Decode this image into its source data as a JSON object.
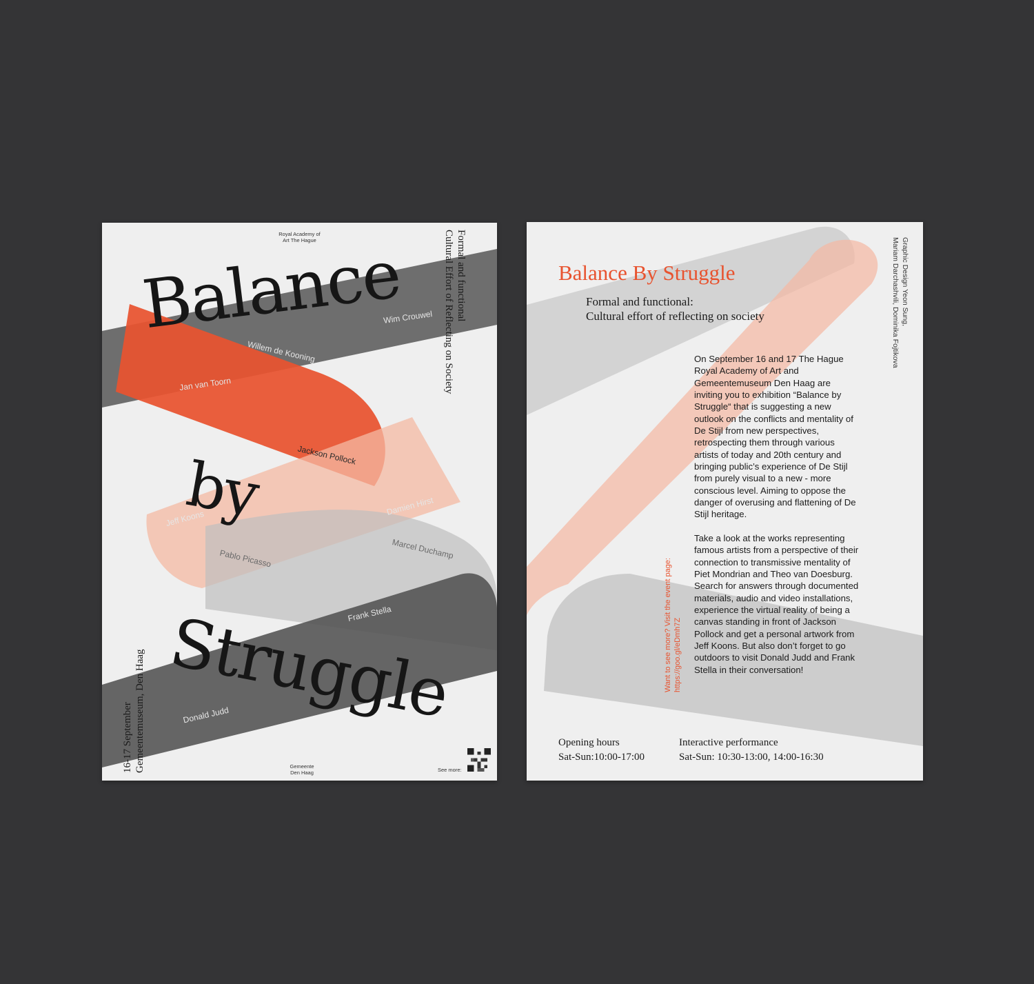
{
  "colors": {
    "background": "#343436",
    "paper": "#efefef",
    "accent": "#e8532f",
    "peach": "#f4b9a3",
    "gray_band": "#606060",
    "light_gray": "#c4c4c4"
  },
  "front": {
    "institution_top": [
      "Royal Academy of",
      "Art The Hague"
    ],
    "title_words": [
      "Balance",
      "by",
      "Struggle"
    ],
    "subtitle_vertical": [
      "Formal and functional",
      "Cultural Effort of Reflecting on Society"
    ],
    "date_vertical": [
      "16-17 September",
      "Gemeentemuseum, Den Haag"
    ],
    "artists": {
      "wim": "Wim Crouwel",
      "willem": "Willem de Kooning",
      "jan": "Jan van Toorn",
      "jackson": "Jackson Pollock",
      "damien": "Damien Hirst",
      "jeff": "Jeff Koons",
      "pablo": "Pablo Picasso",
      "marcel": "Marcel Duchamp",
      "frank": "Frank Stella",
      "donald": "Donald Judd"
    },
    "institution_bottom": [
      "Gemeente",
      "Den Haag"
    ],
    "see_more": "See more:",
    "qr_icon": "qr-code-icon"
  },
  "back": {
    "title": "Balance By Struggle",
    "subtitle": [
      "Formal and functional:",
      "Cultural effort of reflecting on society"
    ],
    "paragraphs": [
      "On September 16 and 17 The Hague Royal Academy of Art and Gemeentemuseum Den Haag are inviting you to exhibition “Balance by Struggle“ that is suggesting a new outlook on the conflicts and mentality of De Stijl from new perspectives, retrospecting them through various artists of today and 20th century and bringing public’s experience of De Stijl from purely visual to a new - more conscious level. Aiming to oppose the danger of overusing and flattening of De Stijl heritage.",
      "Take a look at the works representing famous artists from a perspective of their connection to transmissive mentality of Piet Mondrian and Theo van Doesburg. Search for answers through documented materials, audio and video installations, experience the virtual reality of being a canvas standing in front of Jackson Pollock and get a personal artwork from Jeff Koons. But also don’t forget to go outdoors to visit Donald Judd and Frank Stella in their conversation!"
    ],
    "link_vertical": [
      "Want to see more? Visit the event page:",
      "https://goo.gl/eDmh7Z"
    ],
    "credits_vertical": [
      "Graphic Design Yeon Sung,",
      "Mariam Darchashvili, Dominika Fojtikova"
    ],
    "hours": {
      "opening_label": "Opening hours",
      "opening_value": "Sat-Sun:10:00-17:00",
      "performance_label": "Interactive performance",
      "performance_value": "Sat-Sun: 10:30-13:00, 14:00-16:30"
    }
  }
}
